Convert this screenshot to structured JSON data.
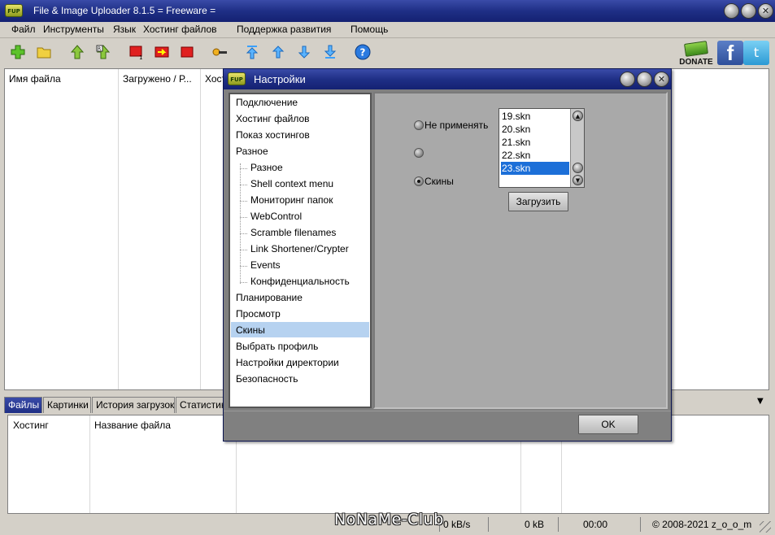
{
  "window": {
    "title": "File & Image Uploader 8.1.5  = Freeware =",
    "icon_text": "FUP"
  },
  "menu": [
    "Файл",
    "Инструменты",
    "Язык",
    "Хостинг файлов",
    "Поддержка развития",
    "Помощь"
  ],
  "toolbar": {
    "icons": [
      "add-icon",
      "folder-icon",
      "upload-icon",
      "resize-upload-icon",
      "stop-one-icon",
      "transfer-icon",
      "stop-icon",
      "key-icon",
      "move-top-icon",
      "move-up-icon",
      "move-down-icon",
      "move-bottom-icon",
      "help-icon"
    ],
    "donate_label": "DONATE",
    "facebook_glyph": "f",
    "twitter_glyph": "t"
  },
  "upper_list": {
    "columns": [
      "Имя файла",
      "Загружено / Р...",
      "Хост"
    ]
  },
  "tabs": [
    "Файлы",
    "Картинки",
    "История загрузок",
    "Статистик"
  ],
  "lower_list": {
    "columns": [
      "Хостинг",
      "Название файла"
    ]
  },
  "status": {
    "watermark": "NoNaMe-Club",
    "speed": "0 kB/s",
    "size": "0 kB",
    "time": "00:00",
    "copyright": "© 2008-2021 z_o_o_m"
  },
  "dialog": {
    "title": "Настройки",
    "tree": [
      {
        "label": "Подключение",
        "child": false
      },
      {
        "label": "Хостинг файлов",
        "child": false
      },
      {
        "label": "Показ хостингов",
        "child": false
      },
      {
        "label": "Разное",
        "child": false
      },
      {
        "label": "Разное",
        "child": true
      },
      {
        "label": "Shell context menu",
        "child": true
      },
      {
        "label": "Мониторинг папок",
        "child": true
      },
      {
        "label": "WebControl",
        "child": true
      },
      {
        "label": "Scramble filenames",
        "child": true
      },
      {
        "label": "Link Shortener/Crypter",
        "child": true
      },
      {
        "label": "Events",
        "child": true
      },
      {
        "label": "Конфиденциальность",
        "child": true
      },
      {
        "label": "Планирование",
        "child": false
      },
      {
        "label": "Просмотр",
        "child": false
      },
      {
        "label": "Скины",
        "child": false,
        "selected": true
      },
      {
        "label": "Выбрать профиль",
        "child": false
      },
      {
        "label": "Настройки директории",
        "child": false
      },
      {
        "label": "Безопасность",
        "child": false
      }
    ],
    "radios": [
      {
        "label": "Не применять",
        "checked": false
      },
      {
        "label": "",
        "checked": false
      },
      {
        "label": "Скины",
        "checked": true
      }
    ],
    "skins": [
      "19.skn",
      "20.skn",
      "21.skn",
      "22.skn",
      "23.skn"
    ],
    "selected_skin": "23.skn",
    "load_button": "Загрузить",
    "ok_button": "OK"
  },
  "colors": {
    "title_blue": "#1f2f86",
    "selection_blue": "#1c6fd8",
    "tree_selection": "#b6d2f0",
    "panel_gray": "#a9a9a9"
  }
}
